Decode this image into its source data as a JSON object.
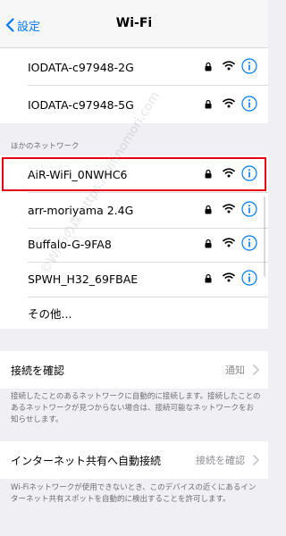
{
  "nav": {
    "back_label": "設定",
    "title": "Wi-Fi"
  },
  "connected_networks": [
    {
      "name": "IODATA-c97948-2G"
    },
    {
      "name": "IODATA-c97948-5G"
    }
  ],
  "other_networks_header": "ほかのネットワーク",
  "other_networks": [
    {
      "name": "AiR-WiFi_0NWHC6",
      "highlighted": true
    },
    {
      "name": "arr-moriyama 2.4G"
    },
    {
      "name": "Buffalo-G-9FA8"
    },
    {
      "name": "SPWH_H32_69FBAE"
    }
  ],
  "other_label": "その他...",
  "ask_to_join": {
    "label": "接続を確認",
    "value": "通知"
  },
  "ask_to_join_footnote": "接続したことのあるネットワークに自動的に接続します。接続したことのあるネットワークが見つからない場合は、接続可能なネットワークをお知らせします。",
  "auto_join_hotspot": {
    "label": "インターネット共有へ自動接続",
    "value": "接続を確認"
  },
  "auto_join_hotspot_footnote": "Wi-Fiネットワークが使用できないとき、このデバイスの近くにあるインターネット共有スポットを自動的に検出することを許可します。",
  "watermark": "©Wi-Fiの森 https://wifinomori.com",
  "colors": {
    "accent": "#007aff",
    "highlight": "#e60012"
  },
  "icons": {
    "back": "chevron-left-icon",
    "lock": "lock-icon",
    "wifi": "wifi-icon",
    "info": "info-icon",
    "chevron": "chevron-right-icon"
  }
}
